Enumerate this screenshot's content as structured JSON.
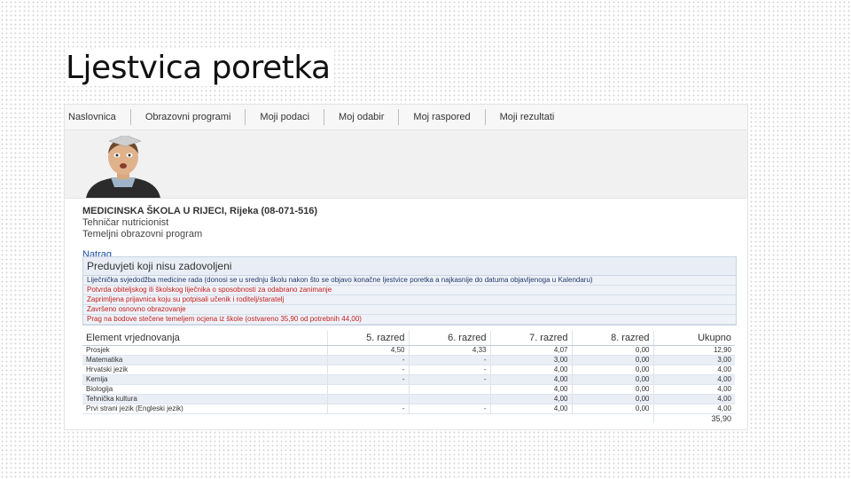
{
  "slide": {
    "title": "Ljestvica poretka"
  },
  "nav": {
    "items": [
      {
        "label": "Naslovnica"
      },
      {
        "label": "Obrazovni programi"
      },
      {
        "label": "Moji podaci"
      },
      {
        "label": "Moj odabir"
      },
      {
        "label": "Moj raspored"
      },
      {
        "label": "Moji rezultati"
      }
    ],
    "active": "Moji rezultati"
  },
  "school": {
    "name": "MEDICINSKA ŠKOLA U RIJECI, Rijeka (08-071-516)",
    "program": "Tehničar nutricionist",
    "type": "Temeljni obrazovni program"
  },
  "back_link": "Natrag",
  "prerequisites": {
    "title": "Preduvjeti koji nisu zadovoljeni",
    "items": [
      "Liječnička svjedodžba medicine rada (donosi se u srednju školu nakon što se objavo konačne ljestvice poretka a najkasnije do datuma objavljenoga u Kalendaru)",
      "Potvrda obiteljskog ili školskog liječnika o sposobnosti za odabrano zanimanje",
      "Zaprimljena prijavnica koju su potpisali učenik i roditelj/staratelj",
      "Završeno osnovno obrazovanje",
      "Prag na bodove stečene temeljem ocjena iz škole (ostvareno 35,90 od potrebnih 44,00)"
    ]
  },
  "grades": {
    "headers": [
      "Element vrjednovanja",
      "5. razred",
      "6. razred",
      "7. razred",
      "8. razred",
      "Ukupno"
    ],
    "rows": [
      [
        "Prosjek",
        "4,50",
        "4,33",
        "4,07",
        "0,00",
        "12,90"
      ],
      [
        "Matematika",
        "-",
        "-",
        "3,00",
        "0,00",
        "3,00"
      ],
      [
        "Hrvatski jezik",
        "-",
        "-",
        "4,00",
        "0,00",
        "4,00"
      ],
      [
        "Kemija",
        "-",
        "-",
        "4,00",
        "0,00",
        "4,00"
      ],
      [
        "Biologija",
        "",
        "",
        "4,00",
        "0,00",
        "4,00"
      ],
      [
        "Tehnička kultura",
        "",
        "",
        "4,00",
        "0,00",
        "4,00"
      ],
      [
        "Prvi strani jezik (Engleski jezik)",
        "-",
        "-",
        "4,00",
        "0,00",
        "4,00"
      ]
    ],
    "total": "35,90"
  },
  "colors": {
    "link": "#1a4ea0",
    "warning_text": "#c32020",
    "row_alt": "#eaeef5"
  },
  "icons": {
    "avatar": "student-avatar-icon"
  }
}
